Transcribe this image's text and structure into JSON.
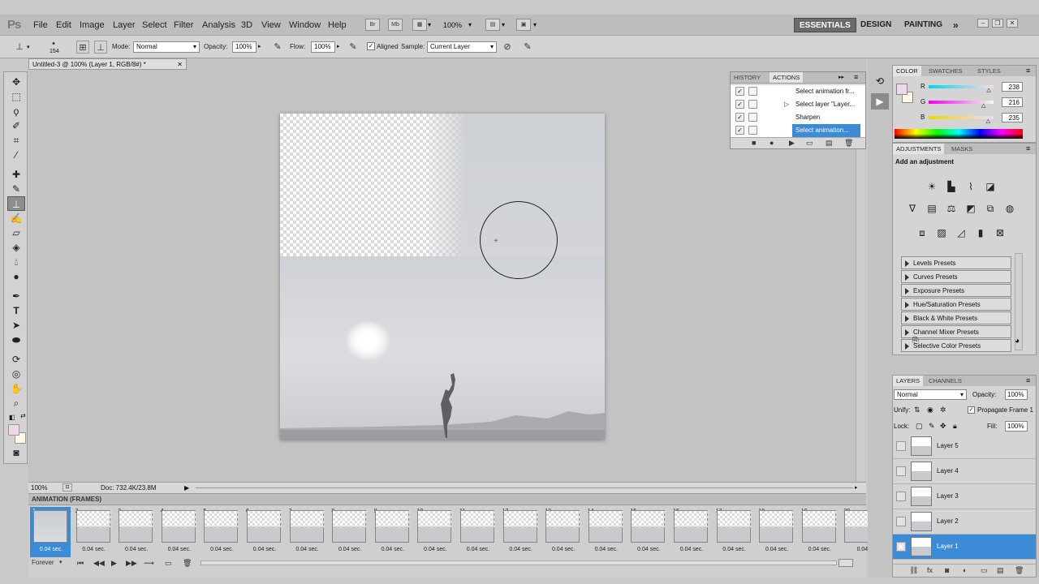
{
  "app": {
    "logo": "Ps"
  },
  "menu": [
    "File",
    "Edit",
    "Image",
    "Layer",
    "Select",
    "Filter",
    "Analysis",
    "3D",
    "View",
    "Window",
    "Help"
  ],
  "menubar": {
    "bridge_label": "Br",
    "minibridge_label": "Mb",
    "zoom": "100%",
    "workspaces": [
      "ESSENTIALS",
      "DESIGN",
      "PAINTING"
    ],
    "more": "»"
  },
  "options": {
    "brush_size": "154",
    "mode_label": "Mode:",
    "mode_value": "Normal",
    "opacity_label": "Opacity:",
    "opacity_value": "100%",
    "flow_label": "Flow:",
    "flow_value": "100%",
    "aligned_label": "Aligned",
    "sample_label": "Sample:",
    "sample_value": "Current Layer"
  },
  "document": {
    "tab_title": "Untitled-3 @ 100% (Layer 1, RGB/8#) *",
    "zoom": "100%",
    "doc_info": "Doc: 732.4K/23.8M"
  },
  "history_panel": {
    "tabs": [
      "HISTORY",
      "ACTIONS"
    ],
    "rows": [
      {
        "label": "Select animation fr...",
        "selected": false
      },
      {
        "label": "Select layer \"Layer...",
        "selected": false
      },
      {
        "label": "Sharpen",
        "selected": false
      },
      {
        "label": "Select animation...",
        "selected": true
      }
    ]
  },
  "color_panel": {
    "tabs": [
      "COLOR",
      "SWATCHES",
      "STYLES"
    ],
    "channels": [
      {
        "label": "R",
        "value": "238",
        "level": 0.93
      },
      {
        "label": "G",
        "value": "216",
        "level": 0.85
      },
      {
        "label": "B",
        "value": "235",
        "level": 0.92
      }
    ],
    "fg_color": "#eed8eb"
  },
  "adjustments_panel": {
    "tabs": [
      "ADJUSTMENTS",
      "MASKS"
    ],
    "heading": "Add an adjustment",
    "presets": [
      "Levels Presets",
      "Curves Presets",
      "Exposure Presets",
      "Hue/Saturation Presets",
      "Black & White Presets",
      "Channel Mixer Presets",
      "Selective Color Presets"
    ]
  },
  "layers_panel": {
    "tabs": [
      "LAYERS",
      "CHANNELS"
    ],
    "blend_mode": "Normal",
    "opacity_label": "Opacity:",
    "opacity_value": "100%",
    "unify_label": "Unify:",
    "propagate_label": "Propagate Frame 1",
    "lock_label": "Lock:",
    "fill_label": "Fill:",
    "fill_value": "100%",
    "layers": [
      {
        "name": "Layer 5",
        "selected": false
      },
      {
        "name": "Layer 4",
        "selected": false
      },
      {
        "name": "Layer 3",
        "selected": false
      },
      {
        "name": "Layer 2",
        "selected": false
      },
      {
        "name": "Layer 1",
        "selected": true
      }
    ]
  },
  "animation_panel": {
    "title": "ANIMATION (FRAMES)",
    "loop": "Forever",
    "frames": [
      {
        "num": "1",
        "time": "0.04 sec."
      },
      {
        "num": "2",
        "time": "0.04 sec."
      },
      {
        "num": "3",
        "time": "0.04 sec."
      },
      {
        "num": "4",
        "time": "0.04 sec."
      },
      {
        "num": "5",
        "time": "0.04 sec."
      },
      {
        "num": "6",
        "time": "0.04 sec."
      },
      {
        "num": "7",
        "time": "0.04 sec."
      },
      {
        "num": "8",
        "time": "0.04 sec."
      },
      {
        "num": "9",
        "time": "0.04 sec."
      },
      {
        "num": "10",
        "time": "0.04 sec."
      },
      {
        "num": "11",
        "time": "0.04 sec."
      },
      {
        "num": "12",
        "time": "0.04 sec."
      },
      {
        "num": "13",
        "time": "0.04 sec."
      },
      {
        "num": "14",
        "time": "0.04 sec."
      },
      {
        "num": "15",
        "time": "0.04 sec."
      },
      {
        "num": "16",
        "time": "0.04 sec."
      },
      {
        "num": "17",
        "time": "0.04 sec."
      },
      {
        "num": "18",
        "time": "0.04 sec."
      },
      {
        "num": "19",
        "time": "0.04 sec."
      },
      {
        "num": "20",
        "time": "0.04"
      }
    ],
    "selected_frame": 0
  }
}
